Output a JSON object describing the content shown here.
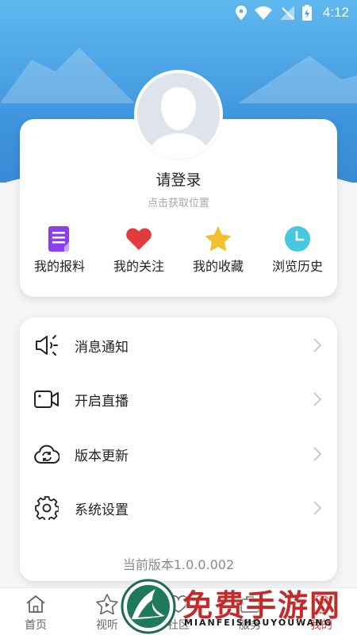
{
  "status_bar": {
    "time": "4:12"
  },
  "profile": {
    "login_label": "请登录",
    "location_label": "点击获取位置",
    "quick_actions": [
      {
        "label": "我的报料",
        "icon": "document-icon",
        "color": "#8b3ff0"
      },
      {
        "label": "我的关注",
        "icon": "heart-icon",
        "color": "#e23b3b"
      },
      {
        "label": "我的收藏",
        "icon": "star-icon",
        "color": "#f2c22e"
      },
      {
        "label": "浏览历史",
        "icon": "clock-icon",
        "color": "#45c8e0"
      }
    ]
  },
  "menu": {
    "items": [
      {
        "label": "消息通知",
        "icon": "speaker-icon"
      },
      {
        "label": "开启直播",
        "icon": "video-camera-icon"
      },
      {
        "label": "版本更新",
        "icon": "cloud-refresh-icon"
      },
      {
        "label": "系统设置",
        "icon": "gear-icon"
      }
    ],
    "version": "当前版本1.0.0.002"
  },
  "tabbar": {
    "tabs": [
      {
        "label": "首页",
        "icon": "home-icon"
      },
      {
        "label": "视听",
        "icon": "play-star-icon"
      },
      {
        "label": "社区",
        "icon": "community-icon"
      },
      {
        "label": "服务",
        "icon": "service-icon"
      },
      {
        "label": "我的",
        "icon": "profile-icon",
        "active": true
      }
    ]
  },
  "watermark": {
    "title": "免费手游网",
    "subtitle": "MIANFEISHOUYOUWANG"
  },
  "colors": {
    "header_blue": "#3d93dc",
    "active_tab": "#e23b3b"
  }
}
